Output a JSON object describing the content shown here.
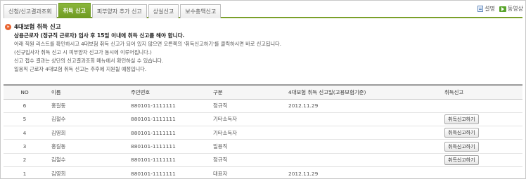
{
  "tabs": [
    {
      "label": "신청/신고결과조회",
      "active": false
    },
    {
      "label": "취득 신고",
      "active": true
    },
    {
      "label": "피부양자 추가 신고",
      "active": false
    },
    {
      "label": "상실신고",
      "active": false
    },
    {
      "label": "보수총액신고",
      "active": false
    }
  ],
  "top_links": {
    "manual": "설명",
    "video": "동영상"
  },
  "section": {
    "icon": "»",
    "title": "4대보험 취득 신고"
  },
  "notices": [
    "상용근로자 (정규직 근로자) 입사 후 15일 이내에 취득 신고를 해야 합니다.",
    "아래 직원 리스트를 확인하시고 4대보험 취득 신고가 되어 있지 않으면 오른쪽의 '취득신고하기'를 클릭하시면 바로 신고됩니다.",
    "(신규입사자 취득 신고 시 피부양자 신고가 동시에 이루어집니다.)",
    "신고 접수 결과는 상단의 신고결과조회 메뉴에서 확인하실 수 있습니다.",
    "일용직 근로자 4대보험 취득 신고는 추후에 지원될 예정입니다."
  ],
  "table": {
    "headers": {
      "no": "NO",
      "name": "이름",
      "rrn": "주민번호",
      "type": "구분",
      "date": "4대보험 취득 신고일(고용보험기준)",
      "action": "취득신고"
    },
    "rows": [
      {
        "no": "6",
        "name": "홍길동",
        "rrn": "880101-1111111",
        "type": "정규직",
        "date": "2012.11.29",
        "action": ""
      },
      {
        "no": "5",
        "name": "김철수",
        "rrn": "880101-1111111",
        "type": "기타소득자",
        "date": "",
        "action": "취득신고하기"
      },
      {
        "no": "4",
        "name": "김영희",
        "rrn": "880101-1111111",
        "type": "기타소득자",
        "date": "",
        "action": "취득신고하기"
      },
      {
        "no": "3",
        "name": "홍길동",
        "rrn": "880101-1111111",
        "type": "일용직",
        "date": "",
        "action": "취득신고하기"
      },
      {
        "no": "2",
        "name": "김철수",
        "rrn": "880101-1111111",
        "type": "정규직",
        "date": "",
        "action": "취득신고하기"
      },
      {
        "no": "1",
        "name": "김영희",
        "rrn": "880101-1111111",
        "type": "대표자",
        "date": "2012.11.29",
        "action": ""
      }
    ]
  }
}
